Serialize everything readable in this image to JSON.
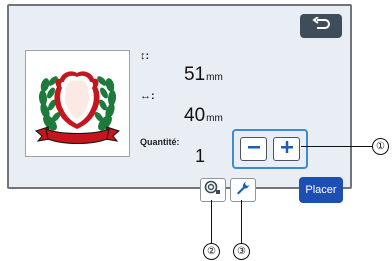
{
  "screen": {
    "width_label": "↕:",
    "width_value": "51",
    "width_unit": "mm",
    "height_label": "↔:",
    "height_value": "40",
    "height_unit": "mm",
    "quantity_label": "Quantité:",
    "quantity_value": "1",
    "place_button": "Placer",
    "minus_label": "−",
    "plus_label": "+"
  },
  "icons": {
    "back": "back-arrow-icon",
    "settings_a": "layout-preview-icon",
    "settings_b": "wrench-icon"
  },
  "callouts": [
    "①",
    "②",
    "③"
  ],
  "colors": {
    "accent": "#3d8bd6",
    "place_button": "#1d4fb3",
    "back_button": "#3f4c5a",
    "laurel_green": "#1e7a3a",
    "ribbon_red": "#c4161c"
  }
}
